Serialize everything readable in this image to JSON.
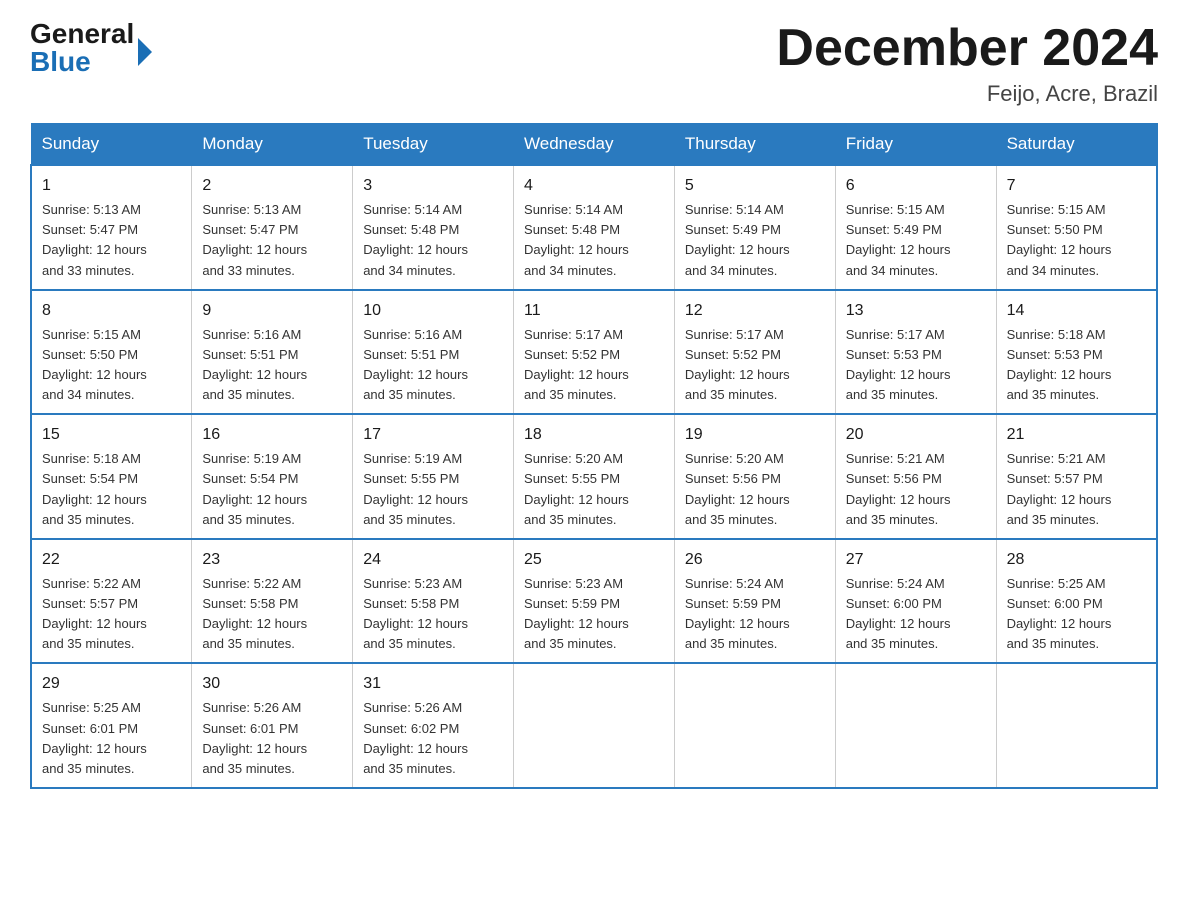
{
  "logo": {
    "general": "General",
    "blue": "Blue"
  },
  "header": {
    "month": "December 2024",
    "location": "Feijo, Acre, Brazil"
  },
  "weekdays": [
    "Sunday",
    "Monday",
    "Tuesday",
    "Wednesday",
    "Thursday",
    "Friday",
    "Saturday"
  ],
  "weeks": [
    [
      {
        "day": "1",
        "sunrise": "5:13 AM",
        "sunset": "5:47 PM",
        "daylight": "12 hours and 33 minutes."
      },
      {
        "day": "2",
        "sunrise": "5:13 AM",
        "sunset": "5:47 PM",
        "daylight": "12 hours and 33 minutes."
      },
      {
        "day": "3",
        "sunrise": "5:14 AM",
        "sunset": "5:48 PM",
        "daylight": "12 hours and 34 minutes."
      },
      {
        "day": "4",
        "sunrise": "5:14 AM",
        "sunset": "5:48 PM",
        "daylight": "12 hours and 34 minutes."
      },
      {
        "day": "5",
        "sunrise": "5:14 AM",
        "sunset": "5:49 PM",
        "daylight": "12 hours and 34 minutes."
      },
      {
        "day": "6",
        "sunrise": "5:15 AM",
        "sunset": "5:49 PM",
        "daylight": "12 hours and 34 minutes."
      },
      {
        "day": "7",
        "sunrise": "5:15 AM",
        "sunset": "5:50 PM",
        "daylight": "12 hours and 34 minutes."
      }
    ],
    [
      {
        "day": "8",
        "sunrise": "5:15 AM",
        "sunset": "5:50 PM",
        "daylight": "12 hours and 34 minutes."
      },
      {
        "day": "9",
        "sunrise": "5:16 AM",
        "sunset": "5:51 PM",
        "daylight": "12 hours and 35 minutes."
      },
      {
        "day": "10",
        "sunrise": "5:16 AM",
        "sunset": "5:51 PM",
        "daylight": "12 hours and 35 minutes."
      },
      {
        "day": "11",
        "sunrise": "5:17 AM",
        "sunset": "5:52 PM",
        "daylight": "12 hours and 35 minutes."
      },
      {
        "day": "12",
        "sunrise": "5:17 AM",
        "sunset": "5:52 PM",
        "daylight": "12 hours and 35 minutes."
      },
      {
        "day": "13",
        "sunrise": "5:17 AM",
        "sunset": "5:53 PM",
        "daylight": "12 hours and 35 minutes."
      },
      {
        "day": "14",
        "sunrise": "5:18 AM",
        "sunset": "5:53 PM",
        "daylight": "12 hours and 35 minutes."
      }
    ],
    [
      {
        "day": "15",
        "sunrise": "5:18 AM",
        "sunset": "5:54 PM",
        "daylight": "12 hours and 35 minutes."
      },
      {
        "day": "16",
        "sunrise": "5:19 AM",
        "sunset": "5:54 PM",
        "daylight": "12 hours and 35 minutes."
      },
      {
        "day": "17",
        "sunrise": "5:19 AM",
        "sunset": "5:55 PM",
        "daylight": "12 hours and 35 minutes."
      },
      {
        "day": "18",
        "sunrise": "5:20 AM",
        "sunset": "5:55 PM",
        "daylight": "12 hours and 35 minutes."
      },
      {
        "day": "19",
        "sunrise": "5:20 AM",
        "sunset": "5:56 PM",
        "daylight": "12 hours and 35 minutes."
      },
      {
        "day": "20",
        "sunrise": "5:21 AM",
        "sunset": "5:56 PM",
        "daylight": "12 hours and 35 minutes."
      },
      {
        "day": "21",
        "sunrise": "5:21 AM",
        "sunset": "5:57 PM",
        "daylight": "12 hours and 35 minutes."
      }
    ],
    [
      {
        "day": "22",
        "sunrise": "5:22 AM",
        "sunset": "5:57 PM",
        "daylight": "12 hours and 35 minutes."
      },
      {
        "day": "23",
        "sunrise": "5:22 AM",
        "sunset": "5:58 PM",
        "daylight": "12 hours and 35 minutes."
      },
      {
        "day": "24",
        "sunrise": "5:23 AM",
        "sunset": "5:58 PM",
        "daylight": "12 hours and 35 minutes."
      },
      {
        "day": "25",
        "sunrise": "5:23 AM",
        "sunset": "5:59 PM",
        "daylight": "12 hours and 35 minutes."
      },
      {
        "day": "26",
        "sunrise": "5:24 AM",
        "sunset": "5:59 PM",
        "daylight": "12 hours and 35 minutes."
      },
      {
        "day": "27",
        "sunrise": "5:24 AM",
        "sunset": "6:00 PM",
        "daylight": "12 hours and 35 minutes."
      },
      {
        "day": "28",
        "sunrise": "5:25 AM",
        "sunset": "6:00 PM",
        "daylight": "12 hours and 35 minutes."
      }
    ],
    [
      {
        "day": "29",
        "sunrise": "5:25 AM",
        "sunset": "6:01 PM",
        "daylight": "12 hours and 35 minutes."
      },
      {
        "day": "30",
        "sunrise": "5:26 AM",
        "sunset": "6:01 PM",
        "daylight": "12 hours and 35 minutes."
      },
      {
        "day": "31",
        "sunrise": "5:26 AM",
        "sunset": "6:02 PM",
        "daylight": "12 hours and 35 minutes."
      },
      null,
      null,
      null,
      null
    ]
  ],
  "labels": {
    "sunrise": "Sunrise:",
    "sunset": "Sunset:",
    "daylight": "Daylight:"
  }
}
